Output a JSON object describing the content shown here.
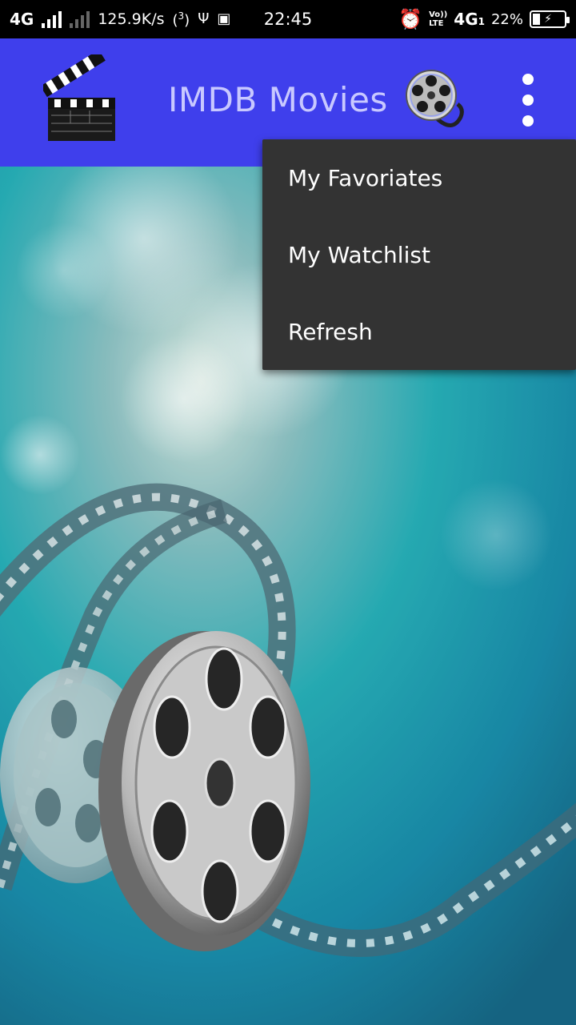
{
  "status_bar": {
    "network": "4G",
    "speed": "125.9K/s",
    "hotspot_label": "3",
    "time": "22:45",
    "volte_top": "Vo))",
    "volte_bottom": "LTE",
    "network2": "4G",
    "network2_sub": "1",
    "battery": "22%"
  },
  "app_bar": {
    "title": "IMDB Movies",
    "color": "#3f3fec"
  },
  "menu": {
    "items": [
      {
        "label": "My Favoriates"
      },
      {
        "label": "My Watchlist"
      },
      {
        "label": "Refresh"
      }
    ]
  },
  "icons": {
    "app_logo": "clapperboard-icon",
    "reel": "film-reel-icon",
    "overflow": "more-vert-icon"
  }
}
